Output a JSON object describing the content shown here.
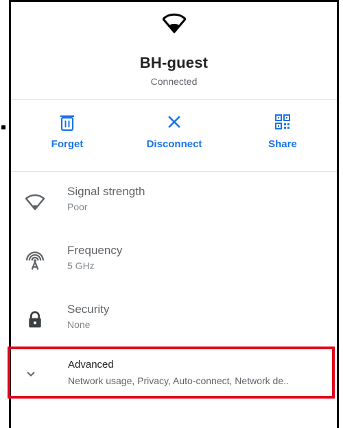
{
  "network": {
    "ssid": "BH-guest",
    "status": "Connected"
  },
  "actions": {
    "forget_label": "Forget",
    "disconnect_label": "Disconnect",
    "share_label": "Share"
  },
  "details": [
    {
      "title": "Signal strength",
      "value": "Poor",
      "icon": "wifi-signal-icon"
    },
    {
      "title": "Frequency",
      "value": "5 GHz",
      "icon": "antenna-icon"
    },
    {
      "title": "Security",
      "value": "None",
      "icon": "lock-icon"
    }
  ],
  "advanced": {
    "title": "Advanced",
    "subtitle": "Network usage, Privacy, Auto-connect, Network de..",
    "icon": "chevron-down-icon"
  },
  "colors": {
    "accent": "#1a73e8",
    "highlight": "#e3001b"
  }
}
